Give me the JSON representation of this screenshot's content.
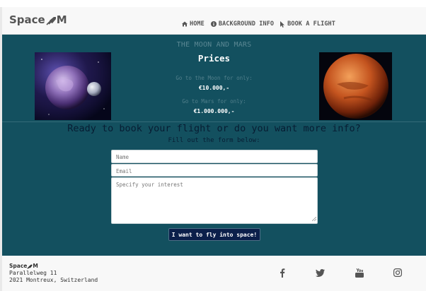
{
  "brand": {
    "name": "Space",
    "logo_suffix_icon": "rocket-icon"
  },
  "nav": {
    "items": [
      {
        "label": "HOME",
        "icon": "home-icon"
      },
      {
        "label": "BACKGROUND INFO",
        "icon": "info-icon"
      },
      {
        "label": "BOOK A FLIGHT",
        "icon": "pointer-icon"
      }
    ]
  },
  "hero": {
    "title": "THE MOON AND MARS",
    "heading": "Prices",
    "moon_line": "Go to the Moon for only:",
    "moon_price": "€10.000,-",
    "mars_line": "Go to Mars for only:",
    "mars_price": "€1.000.000,-",
    "images": [
      "moon-planet-image",
      "mars-planet-image"
    ]
  },
  "form": {
    "heading": "Ready to book your flight or do you want more info?",
    "subheading": "Fill out the form below:",
    "name_placeholder": "Name",
    "email_placeholder": "Email",
    "interest_placeholder": "Specify your interest",
    "submit_label": "I want to fly into space!"
  },
  "footer": {
    "company": "Space",
    "street": "Parallelweg 11",
    "city": "2021 Montreux, Switzerland",
    "social": [
      "facebook-icon",
      "twitter-icon",
      "youtube-icon",
      "instagram-icon"
    ]
  },
  "colors": {
    "section_bg": "#13505f",
    "heading_dark": "#071d33",
    "button_bg": "#0b1f4a",
    "navbar_bg": "#f8f8f8"
  }
}
